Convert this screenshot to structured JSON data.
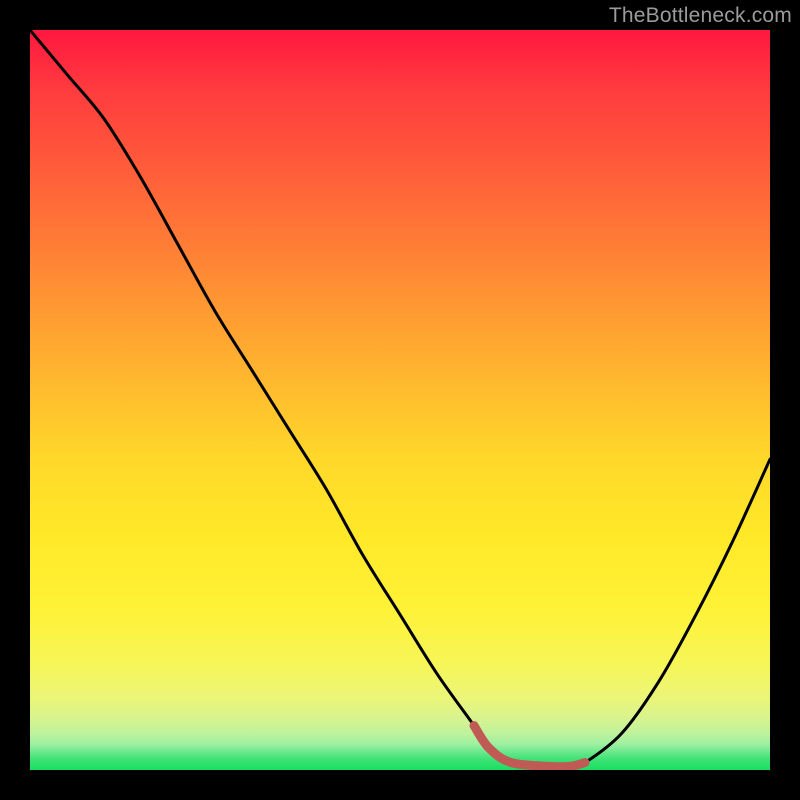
{
  "watermark": "TheBottleneck.com",
  "colors": {
    "page_bg": "#000000",
    "curve": "#000000",
    "accent_segment": "#c05a55",
    "gradient_top": "#ff173f",
    "gradient_bottom": "#18df62"
  },
  "chart_data": {
    "type": "line",
    "title": "",
    "xlabel": "",
    "ylabel": "",
    "xlim": [
      0,
      100
    ],
    "ylim": [
      0,
      100
    ],
    "grid": false,
    "legend": false,
    "series": [
      {
        "name": "bottleneck-curve",
        "x": [
          0,
          5,
          10,
          15,
          20,
          25,
          30,
          35,
          40,
          45,
          50,
          55,
          60,
          62,
          65,
          70,
          73,
          75,
          80,
          85,
          90,
          95,
          100
        ],
        "values": [
          100,
          94,
          88,
          80,
          71,
          62,
          54,
          46,
          38,
          29,
          21,
          13,
          6,
          3,
          1,
          0.5,
          0.5,
          1,
          5,
          12,
          21,
          31,
          42
        ]
      }
    ],
    "accent_range_x": [
      60,
      75
    ],
    "annotations": []
  }
}
